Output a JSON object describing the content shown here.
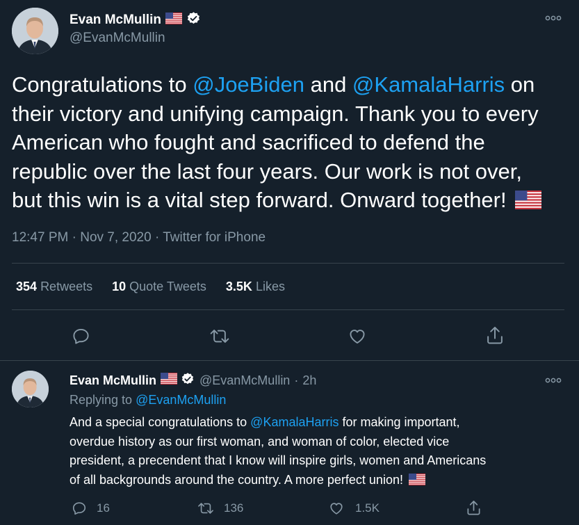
{
  "main_tweet": {
    "author": {
      "name": "Evan McMullin",
      "handle": "@EvanMcMullin",
      "verified": true
    },
    "text": {
      "line1_a": "Congratulations to ",
      "mention1": "@JoeBiden",
      "line1_b": " and ",
      "mention2": "@KamalaHarris",
      "line1_c": " on",
      "line2": "their victory and unifying campaign. Thank you to every",
      "line3": "American who fought and sacrificed to defend the",
      "line4": "republic over the last four years. Our work is not over,",
      "line5": "but this win is a vital step forward. Onward together!"
    },
    "time": "12:47 PM",
    "date": "Nov 7, 2020",
    "source": "Twitter for iPhone",
    "stats": {
      "retweets_count": "354",
      "retweets_label": "Retweets",
      "quotes_count": "10",
      "quotes_label": "Quote Tweets",
      "likes_count": "3.5K",
      "likes_label": "Likes"
    }
  },
  "reply_tweet": {
    "author": {
      "name": "Evan McMullin",
      "handle": "@EvanMcMullin",
      "time": "2h",
      "verified": true
    },
    "replying_prefix": "Replying to ",
    "replying_to": "@EvanMcMullin",
    "text": {
      "line1_a": "And a special congratulations to ",
      "mention": "@KamalaHarris",
      "line1_b": " for making important,",
      "line2": "overdue history as our first woman, and woman of color, elected vice",
      "line3": "president, a precendent that I know will inspire girls, women and Americans",
      "line4": "of all backgrounds around the country. A more perfect union!"
    },
    "actions": {
      "replies": "16",
      "retweets": "136",
      "likes": "1.5K"
    }
  },
  "separator": "·",
  "colors": {
    "background": "#15202b",
    "link": "#1da1f2",
    "muted": "#8899a6",
    "divider": "#38444d"
  },
  "icons": [
    "more-icon",
    "verified-icon",
    "us-flag-icon",
    "reply-icon",
    "retweet-icon",
    "like-icon",
    "share-icon"
  ]
}
